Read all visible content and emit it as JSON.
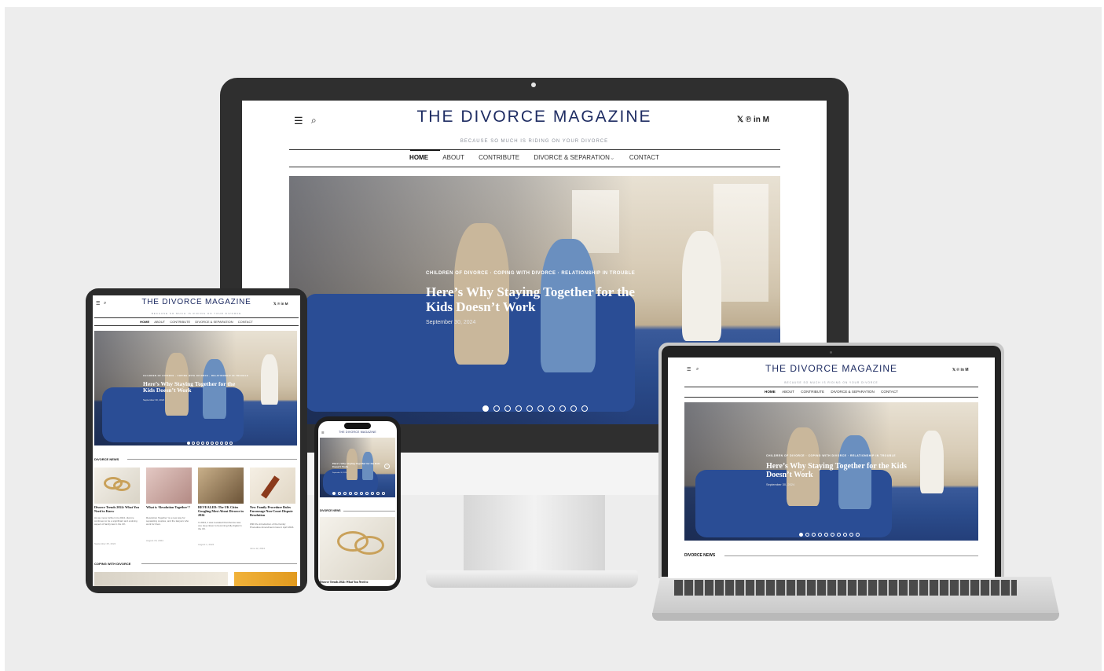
{
  "site": {
    "title": "THE DIVORCE MAGAZINE",
    "tagline": "BECAUSE SO MUCH IS RIDING ON YOUR DIVORCE",
    "nav": [
      "HOME",
      "ABOUT",
      "CONTRIBUTE",
      "DIVORCE & SEPARATION",
      "CONTACT"
    ],
    "nav_active": "HOME",
    "social": [
      "twitter-icon",
      "pinterest-icon",
      "linkedin-icon",
      "medium-icon"
    ],
    "social_glyphs": "𝕏 ℗ in M"
  },
  "hero": {
    "categories": "CHILDREN OF DIVORCE · COPING WITH DIVORCE · RELATIONSHIP IN TROUBLE",
    "title": "Here’s Why Staying Together for the Kids Doesn’t Work",
    "date": "September 30, 2024",
    "slides_total": 10,
    "slide_active": 1
  },
  "sections": {
    "news": "DIVORCE NEWS",
    "coping": "COPING WITH DIVORCE"
  },
  "articles": [
    {
      "title": "Divorce Trends 2024: What You Need to Know",
      "excerpt": "As we move further into 2024, divorce continues to be a significant and evolving aspect of family law in the UK.",
      "meta": "September 25, 2024"
    },
    {
      "title": "What is ‘Resolution Together’?",
      "excerpt": "Resolution Together’ is a new way for separating couples, and the lawyers who work for them.",
      "meta": "August 15, 2024"
    },
    {
      "title": "REVEALED: The UK Cities Googling Most About Divorce in 2024",
      "excerpt": "In 2024, it was revealed that divorce was one step closer to becoming fully digital in the UK.",
      "meta": "August 1, 2024"
    },
    {
      "title": "New Family Procedure Rules Encourage Non-Court Dispute Resolution",
      "excerpt": "With the introduction of the Family Procedure Amendment rules in April 2024.",
      "meta": "June 12, 2024"
    }
  ],
  "phone_article": "Divorce Trends 2024: What You Need to",
  "accent": "#1f2d63"
}
